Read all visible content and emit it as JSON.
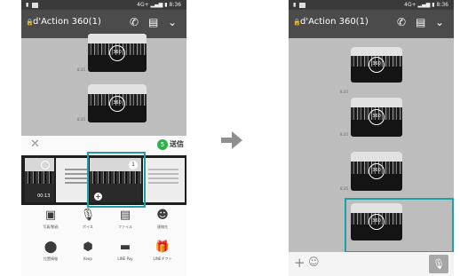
{
  "status": {
    "carrier_icon": "sim-icon",
    "network": "4G+",
    "time": "8:36"
  },
  "chat": {
    "title": "d'Action 360(1)"
  },
  "photo_badge": "360",
  "message_times": [
    "8:35",
    "8:35"
  ],
  "right_message_times": [
    "8:35",
    "8:35",
    "8:35"
  ],
  "sheet": {
    "send_count": "5",
    "send_label": "送信",
    "video_duration": "00:13",
    "selected_number": "1"
  },
  "actions": [
    {
      "label": "写真/動画",
      "icon": "image-icon"
    },
    {
      "label": "ボイス",
      "icon": "mic-icon"
    },
    {
      "label": "ファイル",
      "icon": "file-icon"
    },
    {
      "label": "連絡先",
      "icon": "contact-icon"
    },
    {
      "label": "位置情報",
      "icon": "location-icon"
    },
    {
      "label": "Keep",
      "icon": "keep-icon"
    },
    {
      "label": "LINE Pay",
      "icon": "wallet-icon"
    },
    {
      "label": "LINEギフト",
      "icon": "gift-icon"
    }
  ],
  "colors": {
    "highlight": "#1ba1a6",
    "header": "#4b4b4b",
    "send": "#2bb24c"
  }
}
